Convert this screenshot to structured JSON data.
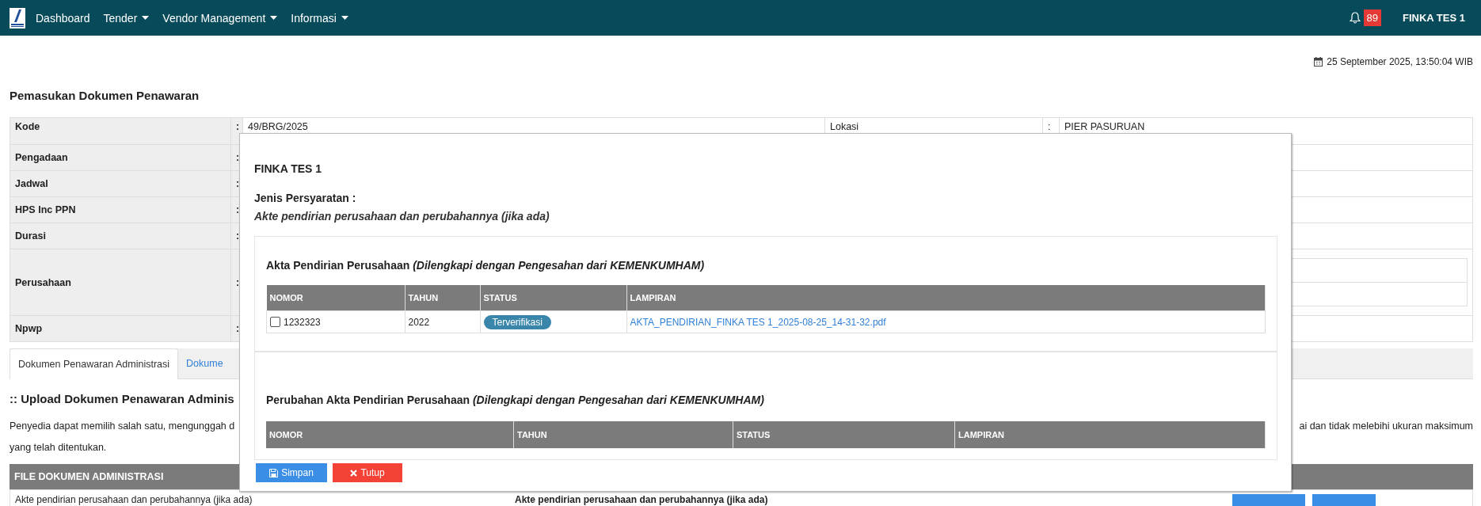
{
  "navbar": {
    "menu": [
      {
        "label": "Dashboard",
        "dropdown": false
      },
      {
        "label": "Tender",
        "dropdown": true
      },
      {
        "label": "Vendor Management",
        "dropdown": true
      },
      {
        "label": "Informasi",
        "dropdown": true
      }
    ],
    "notification_count": "89",
    "user": "FINKA TES 1"
  },
  "datetime": "25 September 2025, 13:50:04 WIB",
  "page_title": "Pemasukan Dokumen Penawaran",
  "info_table": {
    "rows": [
      {
        "label": "Kode",
        "separator": ":",
        "value": "49/BRG/2025",
        "label_2": "Lokasi",
        "separator_2": ":",
        "value_2": "PIER PASURUAN",
        "kind": "plain"
      },
      {
        "label": "Pengadaan",
        "separator": ":",
        "kind": "plain"
      },
      {
        "label": "Jadwal",
        "separator": ":",
        "kind": "plain"
      },
      {
        "label": "HPS Inc PPN",
        "separator": ":",
        "kind": "plain"
      },
      {
        "label": "Durasi",
        "separator": ":",
        "kind": "plain"
      },
      {
        "label": "Perusahaan",
        "separator": ":",
        "kind": "nested"
      },
      {
        "label": "Npwp",
        "separator": ":",
        "kind": "plain"
      }
    ]
  },
  "tabs": [
    {
      "label": "Dokumen Penawaran Administrasi",
      "selected": true
    },
    {
      "label": "Dokume",
      "selected": false
    }
  ],
  "section_title": ":: Upload Dokumen Penawaran Adminis",
  "description": {
    "line_1_start": "Penyedia dapat memilih salah satu, mengunggah d",
    "line_1_end": "ai dan tidak melebihi ukuran maksimum",
    "line_2": "yang telah ditentukan."
  },
  "file_table": {
    "header": "FILE DOKUMEN ADMINISTRASI",
    "rows": [
      {
        "column_1": "Akte pendirian perusahaan dan perubahannya (jika ada)",
        "column_2": "Akte pendirian perusahaan dan perubahannya (jika ada)"
      }
    ]
  },
  "modal": {
    "title": "FINKA TES 1",
    "requirement_label": "Jenis Persyaratan :",
    "requirement": "Akte pendirian perusahaan dan perubahannya (jika ada)",
    "sections": [
      {
        "title": "Akta Pendirian Perusahaan *(Dilengkapi dengan Pengesahan dari KEMENKUMHAM)*",
        "columns": [
          "NOMOR",
          "TAHUN",
          "STATUS",
          "LAMPIRAN"
        ],
        "rows": [
          {
            "nomor": "1232323",
            "checked": false,
            "tahun": "2022",
            "status": "Terverifikasi",
            "lampiran": "AKTA_PENDIRIAN_FINKA TES 1_2025-08-25_14-31-32.pdf"
          }
        ]
      },
      {
        "title": "Perubahan Akta Pendirian Perusahaan *(Dilengkapi dengan Pengesahan dari KEMENKUMHAM)*",
        "columns": [
          "NOMOR",
          "TAHUN",
          "STATUS",
          "LAMPIRAN"
        ]
      }
    ],
    "buttons": [
      {
        "label": "Simpan",
        "kind": "save"
      },
      {
        "label": "Tutup",
        "kind": "close"
      }
    ]
  }
}
